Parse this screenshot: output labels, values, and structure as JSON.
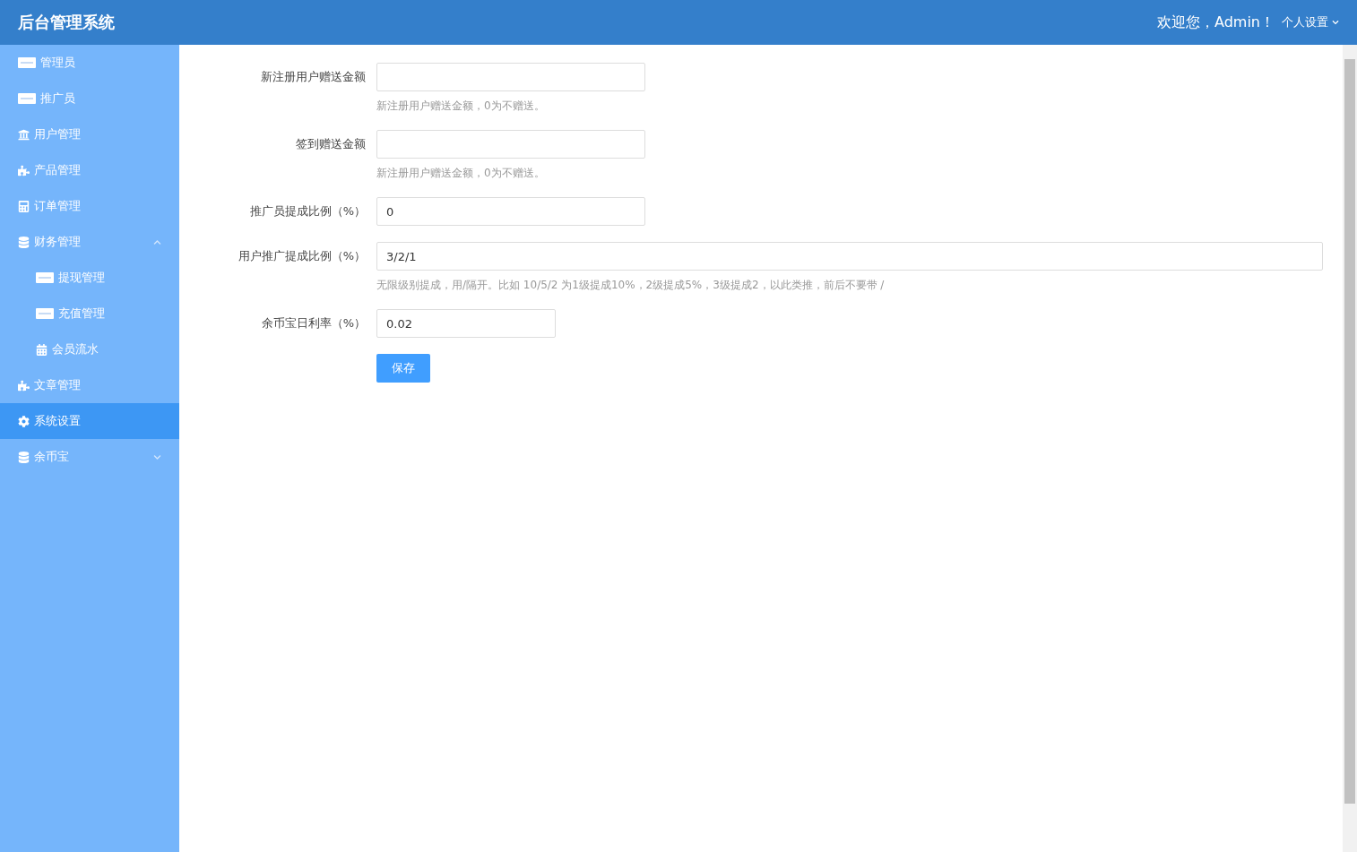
{
  "header": {
    "title": "后台管理系统",
    "welcome": "欢迎您，Admin！",
    "settings_menu": "个人设置"
  },
  "sidebar": {
    "items": [
      {
        "label": "管理员",
        "selected": false
      },
      {
        "label": "推广员",
        "selected": false
      },
      {
        "label": "用户管理",
        "selected": false
      },
      {
        "label": "产品管理",
        "selected": false
      },
      {
        "label": "订单管理",
        "selected": false
      },
      {
        "label": "财务管理",
        "selected": false,
        "expanded": true,
        "children": [
          {
            "label": "提现管理",
            "selected": false
          },
          {
            "label": "充值管理",
            "selected": false
          },
          {
            "label": "会员流水",
            "selected": false
          }
        ]
      },
      {
        "label": "文章管理",
        "selected": false
      },
      {
        "label": "系统设置",
        "selected": true
      },
      {
        "label": "余币宝",
        "selected": false,
        "expanded": false
      }
    ]
  },
  "form": {
    "fields": [
      {
        "label": "新注册用户赠送金额",
        "hint": "新注册用户赠送金额，0为不赠送。"
      },
      {
        "label": "签到赠送金额",
        "hint": "新注册用户赠送金额，0为不赠送。"
      },
      {
        "label": "推广员提成比例（%）",
        "value": "0"
      },
      {
        "label": "用户推广提成比例（%）",
        "value": "3/2/1",
        "hint": "无限级别提成，用/隔开。比如 10/5/2 为1级提成10%，2级提成5%，3级提成2，以此类推，前后不要带 /"
      },
      {
        "label": "余币宝日利率（%）",
        "value": "0.02"
      }
    ],
    "submit": "保存"
  }
}
